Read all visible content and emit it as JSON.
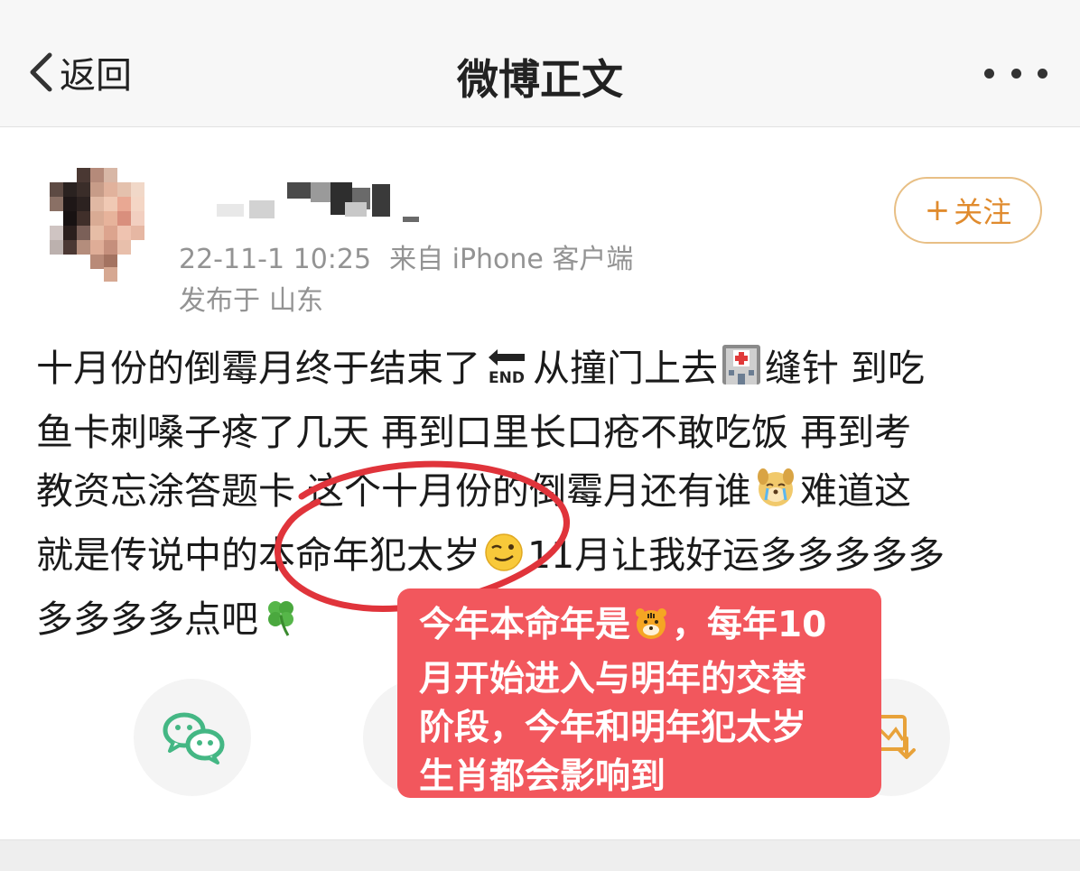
{
  "nav": {
    "back_label": "返回",
    "title": "微博正文"
  },
  "author": {
    "meta_time": "22-11-1 10:25",
    "meta_source": "来自 iPhone 客户端",
    "location_prefix": "发布于",
    "location": "山东"
  },
  "follow": {
    "plus": "+",
    "label": "关注"
  },
  "post": {
    "line1_a": "十月份的倒霉月终于结束了",
    "line1_b": "从撞门上去",
    "line1_c": "缝针 到吃",
    "line2": "鱼卡刺嗓子疼了几天 再到口里长口疮不敢吃饭 再到考",
    "line3_a": "教资忘涂答题卡 这个十月份的倒霉月还有谁",
    "line3_b": "难道这",
    "line4_a": "就是传说中的本命年犯太岁",
    "line4_b": "11月让我好运多多多多多",
    "line5": "多多多多点吧",
    "emoji_end_badge": "END"
  },
  "annotation": {
    "line1_a": "今年本命年是",
    "line1_b": "，每年10",
    "line2": "月开始进入与明年的交替",
    "line3": "阶段，今年和明年犯太岁",
    "line4": "生肖都会影响到"
  },
  "colors": {
    "nav_bg": "#f7f7f7",
    "follow_accent": "#e08b2e",
    "follow_border": "#e8bf85",
    "meta_text": "#939393",
    "annotation_red": "#f2575d",
    "circle_stroke": "#e0343b",
    "wechat_green": "#44b784",
    "save_orange": "#e8a23a"
  }
}
